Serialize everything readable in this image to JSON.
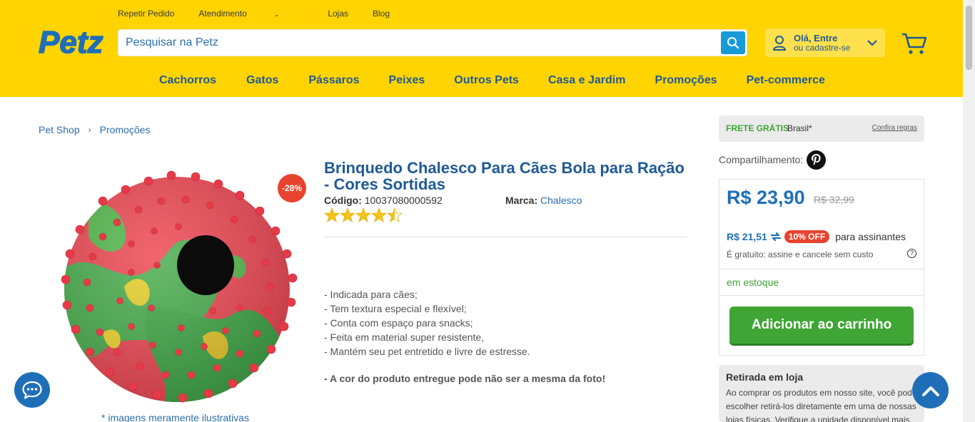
{
  "header": {
    "top_links": [
      {
        "label": "Repetir Pedido"
      },
      {
        "label": "Atendimento",
        "has_dropdown": true
      },
      {
        "label": "Lojas"
      },
      {
        "label": "Blog"
      }
    ],
    "logo_text": "Petz",
    "search": {
      "placeholder": "Pesquisar na Petz",
      "value": ""
    },
    "account": {
      "line1": "Olá, Entre",
      "line2": "ou cadastre-se"
    },
    "nav": [
      {
        "label": "Cachorros"
      },
      {
        "label": "Gatos"
      },
      {
        "label": "Pássaros"
      },
      {
        "label": "Peixes"
      },
      {
        "label": "Outros Pets"
      },
      {
        "label": "Casa e Jardim"
      },
      {
        "label": "Promoções"
      },
      {
        "label": "Pet-commerce"
      }
    ]
  },
  "breadcrumb": {
    "items": [
      {
        "label": "Pet Shop"
      },
      {
        "label": "Promoções"
      }
    ],
    "separator": "›"
  },
  "product": {
    "discount_badge": "-28%",
    "image_note": "* imagens meramente ilustrativas",
    "title": "Brinquedo Chalesco Para Cães Bola para Ração - Cores Sortidas",
    "code_label": "Código:",
    "code": "10037080000592",
    "brand_label": "Marca:",
    "brand": "Chalesco",
    "rating": 4.5,
    "description": [
      "- Indicada para cães;",
      "- Tem textura especial e flexível;",
      "- Conta com espaço para snacks;",
      "- Feita em material super resistente,",
      "- Mantém seu pet entretido e livre de estresse."
    ],
    "warning": "- A cor do produto entregue pode não ser a mesma da foto!"
  },
  "shipping": {
    "label": "FRETE GRÁTIS",
    "region": "Brasil*",
    "rules_link": "Confira regras"
  },
  "share": {
    "label": "Compartilhamento:"
  },
  "pricing": {
    "price": "R$ 23,90",
    "old_price": "R$ 32,99",
    "subscriber_price": "R$ 21,51",
    "subscriber_badge": "10% OFF",
    "subscriber_label": "para assinantes",
    "subscriber_note": "É gratuito: assine e cancele sem custo",
    "help": "?",
    "stock": "em estoque",
    "add_to_cart": "Adicionar ao carrinho"
  },
  "pickup": {
    "title": "Retirada em loja",
    "text": "Ao comprar os produtos em nosso site, você pode escolher retirá-los diretamente em uma de nossas lojas físicas. Verifique a unidade disponível mais"
  },
  "colors": {
    "header_bg": "#ffd400",
    "brand_blue": "#1f5a96",
    "price_blue": "#1f6fb8",
    "green": "#3fa535",
    "red_badge": "#e8432e"
  }
}
